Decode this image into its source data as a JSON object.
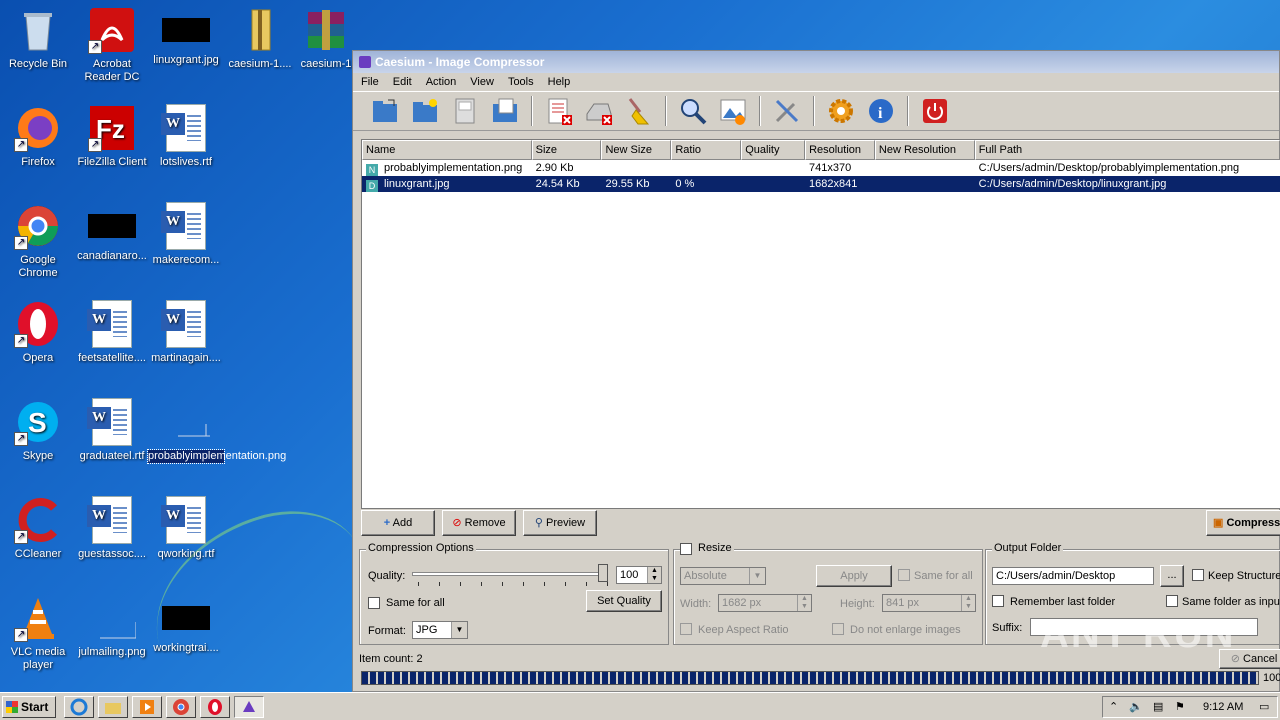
{
  "desktop": {
    "icons": [
      {
        "label": "Recycle Bin"
      },
      {
        "label": "Acrobat Reader DC"
      },
      {
        "label": "linuxgrant.jpg"
      },
      {
        "label": "caesium-1...."
      },
      {
        "label": "caesium-1"
      },
      {
        "label": "Firefox"
      },
      {
        "label": "FileZilla Client"
      },
      {
        "label": "lotslives.rtf"
      },
      {
        "label": "Google Chrome"
      },
      {
        "label": "canadianaro..."
      },
      {
        "label": "makerecom..."
      },
      {
        "label": "Opera"
      },
      {
        "label": "feetsatellite...."
      },
      {
        "label": "martinagain...."
      },
      {
        "label": "Skype"
      },
      {
        "label": "graduateel.rtf"
      },
      {
        "label": "probablyimplementation.png"
      },
      {
        "label": "CCleaner"
      },
      {
        "label": "guestassoc...."
      },
      {
        "label": "qworking.rtf"
      },
      {
        "label": "VLC media player"
      },
      {
        "label": "julmailing.png"
      },
      {
        "label": "workingtrai...."
      }
    ]
  },
  "window": {
    "title": "Caesium - Image Compressor",
    "menu": [
      "File",
      "Edit",
      "Action",
      "View",
      "Tools",
      "Help"
    ],
    "toolbar": [
      "open-folder-icon",
      "add-folder-icon",
      "save-icon",
      "copy-icon",
      "remove-item-icon",
      "clear-list-icon",
      "broom-icon",
      "zoom-icon",
      "preview-image-icon",
      "tools-icon",
      "settings-gear-icon",
      "info-icon",
      "power-icon"
    ],
    "columns": [
      "Name",
      "Size",
      "New Size",
      "Ratio",
      "Quality",
      "Resolution",
      "New Resolution",
      "Full Path"
    ],
    "rows": [
      {
        "name": "probablyimplementation.png",
        "size": "2.90 Kb",
        "new_size": "",
        "ratio": "",
        "quality": "",
        "resolution": "741x370",
        "new_resolution": "",
        "path": "C:/Users/admin/Desktop/probablyimplementation.png",
        "icon": "N"
      },
      {
        "name": "linuxgrant.jpg",
        "size": "24.54 Kb",
        "new_size": "29.55 Kb",
        "ratio": "0 %",
        "quality": "",
        "resolution": "1682x841",
        "new_resolution": "",
        "path": "C:/Users/admin/Desktop/linuxgrant.jpg",
        "icon": "D"
      }
    ],
    "buttons": {
      "add": "Add",
      "remove": "Remove",
      "preview": "Preview",
      "compress": "Compress",
      "cancel": "Cancel"
    },
    "compression": {
      "title": "Compression Options",
      "quality_label": "Quality:",
      "quality_value": "100",
      "same_for_all": "Same for all",
      "set_quality": "Set Quality",
      "format_label": "Format:",
      "format_value": "JPG"
    },
    "resize": {
      "title": "Resize",
      "mode": "Absolute",
      "apply": "Apply",
      "same_for_all": "Same for all",
      "width_label": "Width:",
      "width_value": "1682 px",
      "height_label": "Height:",
      "height_value": "841 px",
      "keep_aspect": "Keep Aspect Ratio",
      "no_enlarge": "Do not enlarge images"
    },
    "output": {
      "title": "Output Folder",
      "path": "C:/Users/admin/Desktop",
      "browse": "...",
      "keep_structure": "Keep Structure",
      "remember": "Remember last folder",
      "same_folder": "Same folder as input",
      "suffix_label": "Suffix:"
    },
    "status": {
      "item_count": "Item count: 2",
      "progress_text": "100",
      "progress": 1.0
    }
  },
  "taskbar": {
    "start": "Start",
    "clock": "9:12 AM"
  },
  "watermark": "ANY RUN"
}
